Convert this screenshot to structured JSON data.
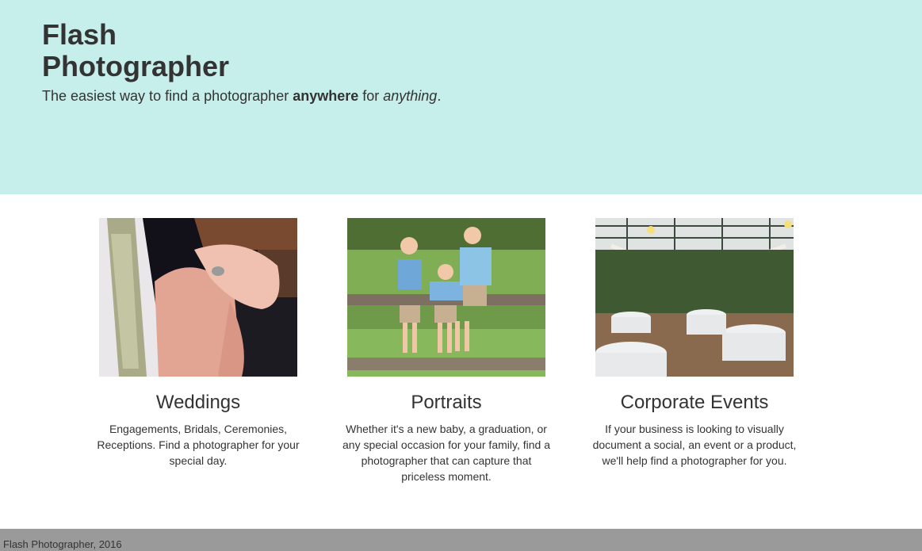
{
  "header": {
    "brand_line1": "Flash",
    "brand_line2": "Photographer",
    "tagline": {
      "before": "The easiest way to find a photographer ",
      "bold": "anywhere",
      "middle": " for ",
      "italic": "anything",
      "after": "."
    },
    "background": "#c6eeea"
  },
  "services": [
    {
      "title": "Weddings",
      "description": "Engagements, Bridals, Ceremonies, Receptions. Find a photographer for your special day.",
      "image": "wedding-rings-photo"
    },
    {
      "title": "Portraits",
      "description": "Whether it's a new baby, a graduation, or any special occasion for your family, find a photographer that can capture that priceless moment.",
      "image": "children-portrait-photo"
    },
    {
      "title": "Corporate Events",
      "description": "If your business is looking to visually document a social, an event or a product, we'll help find a photographer for you.",
      "image": "event-venue-photo"
    }
  ],
  "footer": {
    "text": "Flash Photographer, 2016",
    "background": "#9a9a9a"
  }
}
